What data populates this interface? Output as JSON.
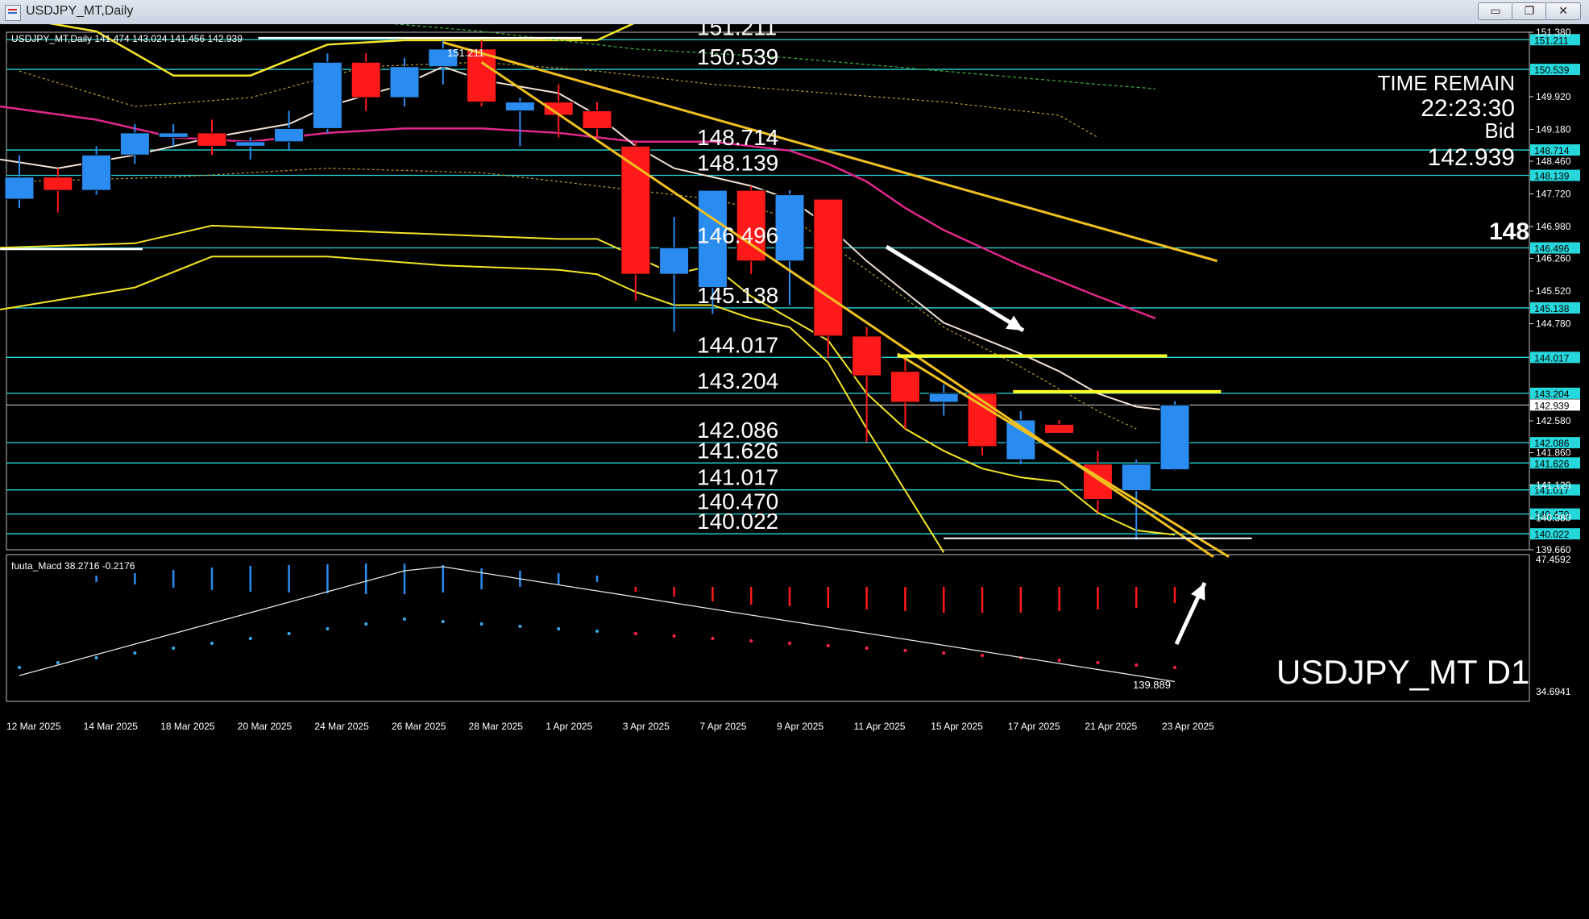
{
  "window": {
    "title": "USDJPY_MT,Daily",
    "buttons": [
      {
        "label": "▭",
        "name": "minimize"
      },
      {
        "label": "❐",
        "name": "restore"
      },
      {
        "label": "✕",
        "name": "close"
      }
    ]
  },
  "chart_data": {
    "type": "candlestick",
    "header": "USDJPY_MT,Daily  141.474 143.024 141.456 142.939",
    "price_axis": {
      "ylim": [
        139.66,
        151.38
      ],
      "ticks": [
        "151.380",
        "149.920",
        "149.180",
        "148.460",
        "147.720",
        "146.980",
        "146.260",
        "145.520",
        "144.780",
        "142.580",
        "141.860",
        "141.120",
        "140.380",
        "139.660"
      ]
    },
    "dates": [
      "12 Mar 2025",
      "14 Mar 2025",
      "18 Mar 2025",
      "20 Mar 2025",
      "24 Mar 2025",
      "26 Mar 2025",
      "28 Mar 2025",
      "1 Apr 2025",
      "3 Apr 2025",
      "7 Apr 2025",
      "9 Apr 2025",
      "11 Apr 2025",
      "15 Apr 2025",
      "17 Apr 2025",
      "21 Apr 2025",
      "23 Apr 2025"
    ],
    "candles": [
      {
        "o": 147.6,
        "h": 148.6,
        "l": 147.4,
        "c": 148.1
      },
      {
        "o": 148.1,
        "h": 148.3,
        "l": 147.3,
        "c": 147.8
      },
      {
        "o": 147.8,
        "h": 148.8,
        "l": 147.7,
        "c": 148.6
      },
      {
        "o": 148.6,
        "h": 149.3,
        "l": 148.4,
        "c": 149.1
      },
      {
        "o": 149.0,
        "h": 149.3,
        "l": 148.8,
        "c": 149.1
      },
      {
        "o": 149.1,
        "h": 149.4,
        "l": 148.6,
        "c": 148.8
      },
      {
        "o": 148.8,
        "h": 149.0,
        "l": 148.5,
        "c": 148.9
      },
      {
        "o": 148.9,
        "h": 149.6,
        "l": 148.7,
        "c": 149.2
      },
      {
        "o": 149.2,
        "h": 150.9,
        "l": 149.1,
        "c": 150.7
      },
      {
        "o": 150.7,
        "h": 150.9,
        "l": 149.6,
        "c": 149.9
      },
      {
        "o": 149.9,
        "h": 150.8,
        "l": 149.7,
        "c": 150.6
      },
      {
        "o": 150.6,
        "h": 151.2,
        "l": 150.2,
        "c": 151.0
      },
      {
        "o": 151.0,
        "h": 151.2,
        "l": 149.7,
        "c": 149.8
      },
      {
        "o": 149.6,
        "h": 149.9,
        "l": 148.8,
        "c": 149.8
      },
      {
        "o": 149.8,
        "h": 150.2,
        "l": 149.0,
        "c": 149.5
      },
      {
        "o": 149.6,
        "h": 149.8,
        "l": 149.0,
        "c": 149.2
      },
      {
        "o": 148.8,
        "h": 148.9,
        "l": 145.3,
        "c": 145.9
      },
      {
        "o": 145.9,
        "h": 147.2,
        "l": 144.6,
        "c": 146.5
      },
      {
        "o": 145.6,
        "h": 147.7,
        "l": 145.0,
        "c": 147.8
      },
      {
        "o": 147.8,
        "h": 147.9,
        "l": 145.9,
        "c": 146.2
      },
      {
        "o": 146.2,
        "h": 147.8,
        "l": 145.2,
        "c": 147.7
      },
      {
        "o": 147.6,
        "h": 147.6,
        "l": 144.0,
        "c": 144.5
      },
      {
        "o": 144.5,
        "h": 144.7,
        "l": 142.1,
        "c": 143.6
      },
      {
        "o": 143.7,
        "h": 144.0,
        "l": 142.4,
        "c": 143.0
      },
      {
        "o": 143.0,
        "h": 143.4,
        "l": 142.7,
        "c": 143.2
      },
      {
        "o": 143.2,
        "h": 143.2,
        "l": 141.8,
        "c": 142.0
      },
      {
        "o": 141.7,
        "h": 142.8,
        "l": 141.6,
        "c": 142.6
      },
      {
        "o": 142.5,
        "h": 142.6,
        "l": 142.3,
        "c": 142.3
      },
      {
        "o": 141.6,
        "h": 141.9,
        "l": 140.5,
        "c": 140.8
      },
      {
        "o": 141.0,
        "h": 141.7,
        "l": 139.889,
        "c": 141.6
      },
      {
        "o": 141.474,
        "h": 143.024,
        "l": 141.456,
        "c": 142.939
      }
    ],
    "levels": [
      {
        "price": 151.211,
        "label": "151.211"
      },
      {
        "price": 150.539,
        "label": "150.539"
      },
      {
        "price": 148.714,
        "label": "148.714"
      },
      {
        "price": 148.139,
        "label": "148.139"
      },
      {
        "price": 146.496,
        "label": "146.496"
      },
      {
        "price": 145.138,
        "label": "145.138"
      },
      {
        "price": 144.017,
        "label": "144.017"
      },
      {
        "price": 143.204,
        "label": "143.204"
      },
      {
        "price": 142.086,
        "label": "142.086"
      },
      {
        "price": 141.626,
        "label": "141.626"
      },
      {
        "price": 141.017,
        "label": "141.017"
      },
      {
        "price": 140.47,
        "label": "140.470"
      },
      {
        "price": 140.022,
        "label": "140.022"
      }
    ],
    "current_price": {
      "price": 142.939,
      "label": "142.939"
    },
    "annotations": {
      "high_label": "151.211",
      "low_label": "139.889",
      "time_remain_label": "TIME REMAIN",
      "time_remain": "22:23:30",
      "bid_label": "Bid",
      "bid": "142.939",
      "side_number": "148",
      "watermark": "USDJPY_MT D1"
    },
    "macd": {
      "header": "fuuta_Macd 38.2716  -0.2176",
      "ylim": [
        34.6941,
        47.4592
      ],
      "ticks": [
        "47.4592",
        "34.6941"
      ]
    },
    "colors": {
      "bull": "#2a8cf0",
      "bear": "#ff1a1a",
      "level": "#26d8dc",
      "trend": "#f0c020",
      "bands": "#f5e528",
      "ma_pink": "#e0288a",
      "ma_white": "#f2e0d2",
      "axis_text": "#ffffff"
    }
  }
}
